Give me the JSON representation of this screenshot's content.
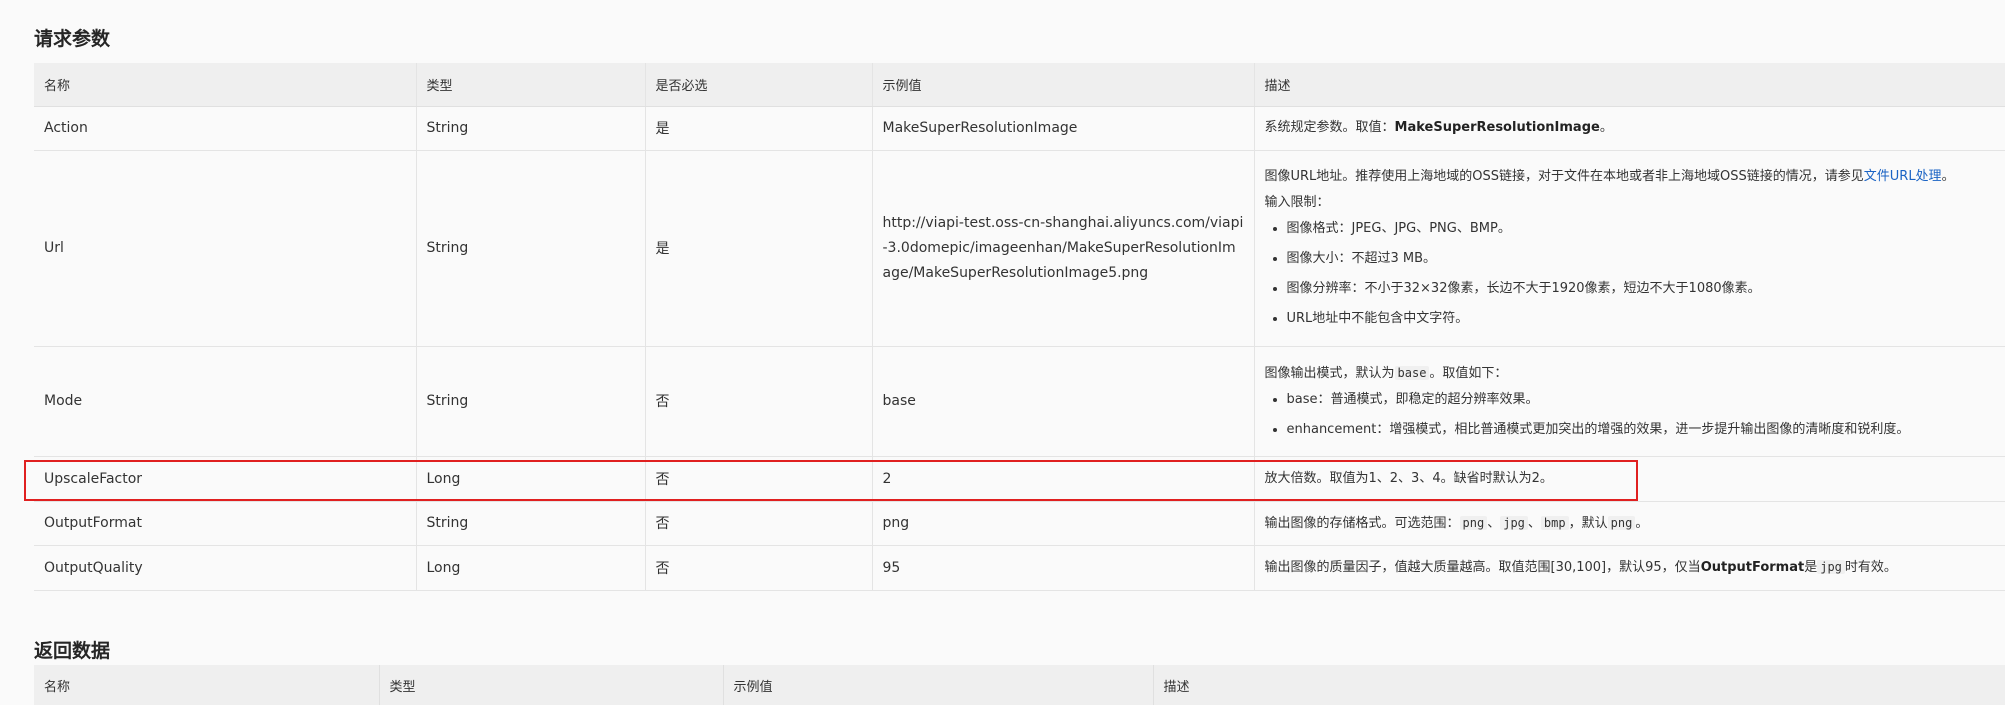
{
  "request_section": {
    "title": "请求参数",
    "columns": [
      "名称",
      "类型",
      "是否必选",
      "示例值",
      "描述"
    ],
    "rows": [
      {
        "name": "Action",
        "type": "String",
        "required": "是",
        "example": "MakeSuperResolutionImage",
        "desc_prefix": "系统规定参数。取值：",
        "desc_bold": "MakeSuperResolutionImage",
        "desc_suffix": "。"
      },
      {
        "name": "Url",
        "type": "String",
        "required": "是",
        "example": "http://viapi-test.oss-cn-shanghai.aliyuncs.com/viapi-3.0domepic/imageenhan/MakeSuperResolutionImage/MakeSuperResolutionImage5.png",
        "desc_line1": "图像URL地址。推荐使用上海地域的OSS链接，对于文件在本地或者非上海地域OSS链接的情况，请参见",
        "desc_link": "文件URL处理",
        "desc_line1_end": "。",
        "desc_line2": "输入限制：",
        "desc_items": [
          "图像格式：JPEG、JPG、PNG、BMP。",
          "图像大小：不超过3 MB。",
          "图像分辨率：不小于32×32像素，长边不大于1920像素，短边不大于1080像素。",
          "URL地址中不能包含中文字符。"
        ]
      },
      {
        "name": "Mode",
        "type": "String",
        "required": "否",
        "example": "base",
        "desc_intro_a": "图像输出模式，默认为",
        "desc_intro_code": "base",
        "desc_intro_b": "。取值如下：",
        "desc_items": [
          "base：普通模式，即稳定的超分辨率效果。",
          "enhancement：增强模式，相比普通模式更加突出的增强的效果，进一步提升输出图像的清晰度和锐利度。"
        ]
      },
      {
        "name": "UpscaleFactor",
        "type": "Long",
        "required": "否",
        "example": "2",
        "desc": "放大倍数。取值为1、2、3、4。缺省时默认为2。"
      },
      {
        "name": "OutputFormat",
        "type": "String",
        "required": "否",
        "example": "png",
        "desc_a": "输出图像的存储格式。可选范围：",
        "code1": "png",
        "sep1": "、",
        "code2": "jpg",
        "sep2": "、",
        "code3": "bmp",
        "desc_b": "，默认",
        "code4": "png",
        "desc_c": "。"
      },
      {
        "name": "OutputQuality",
        "type": "Long",
        "required": "否",
        "example": "95",
        "desc_a": "输出图像的质量因子，值越大质量越高。取值范围[30,100]，默认95，仅当",
        "desc_bold": "OutputFormat",
        "desc_b": "是",
        "desc_code": "jpg",
        "desc_c": "时有效。"
      }
    ]
  },
  "response_section": {
    "title": "返回数据",
    "columns": [
      "名称",
      "类型",
      "示例值",
      "描述"
    ]
  },
  "colors": {
    "highlight": "#e02020",
    "link": "#1a63c4",
    "header_bg": "#efefef"
  }
}
